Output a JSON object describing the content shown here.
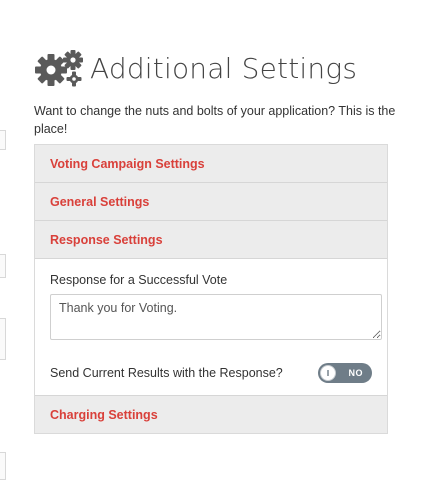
{
  "header": {
    "icon": "gears-icon",
    "title": "Additional Settings",
    "description": "Want to change the nuts and bolts of your application? This is the place!"
  },
  "sections": {
    "voting_campaign": {
      "label": "Voting Campaign Settings"
    },
    "general": {
      "label": "General Settings"
    },
    "response": {
      "label": "Response Settings",
      "success_label": "Response for a Successful Vote",
      "success_value": "Thank you for Voting.",
      "send_results_label": "Send Current Results with the Response?",
      "send_results_toggle": "NO"
    },
    "charging": {
      "label": "Charging Settings"
    }
  },
  "colors": {
    "accent_red": "#d9403a",
    "toggle_off": "#6f7d88",
    "header_bg": "#ececec"
  }
}
